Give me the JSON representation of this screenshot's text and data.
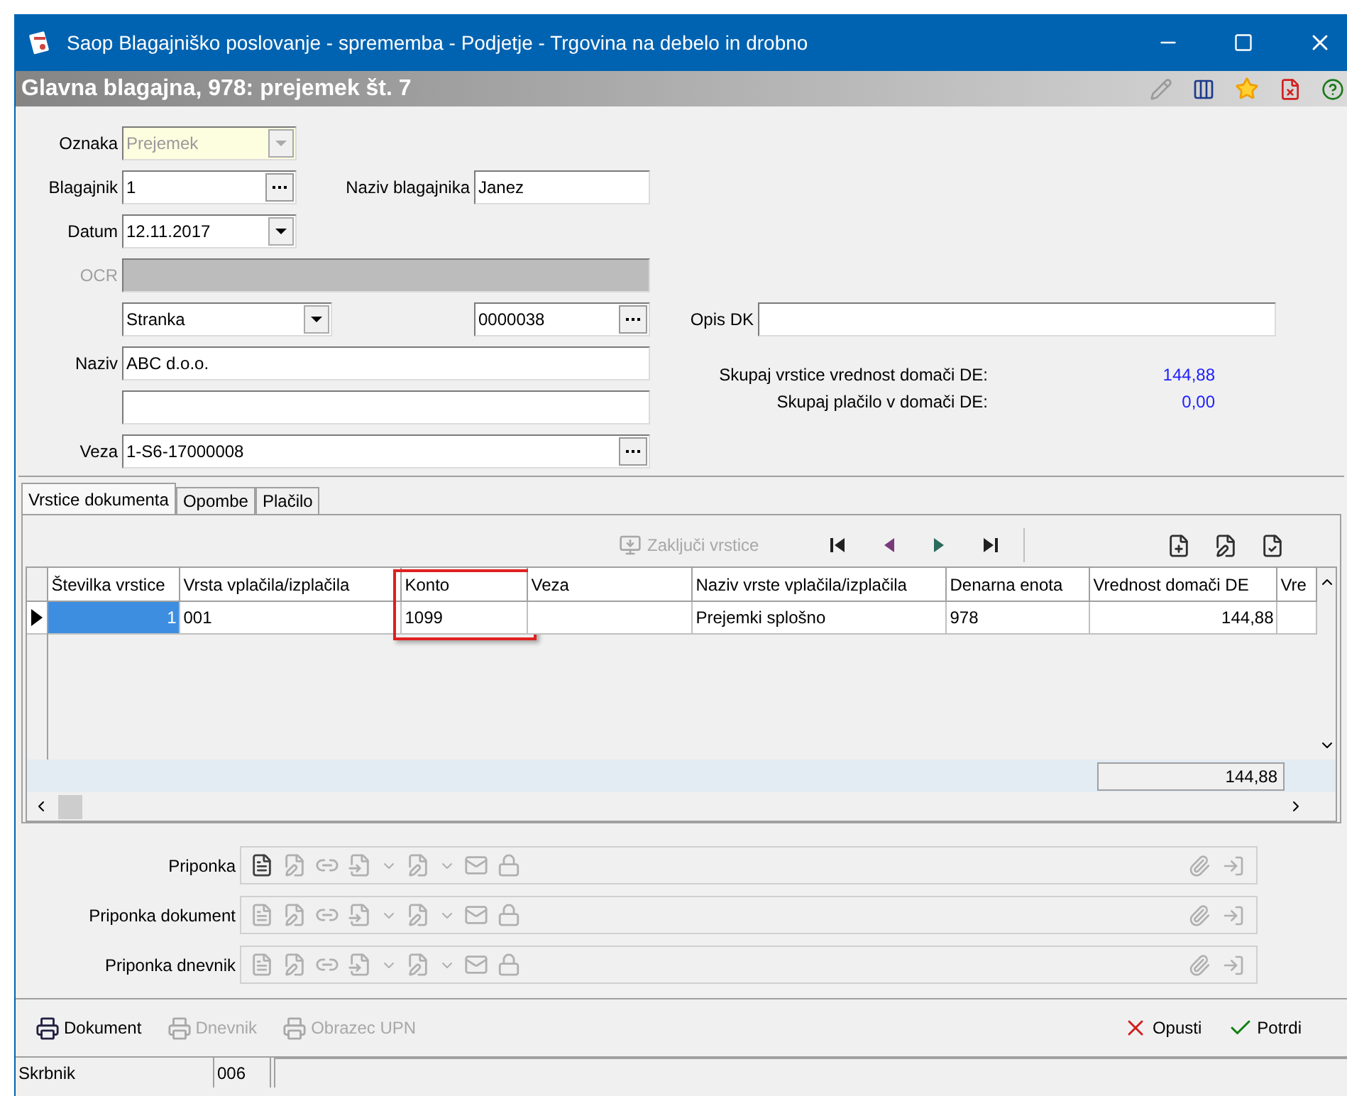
{
  "window": {
    "title": "Saop Blagajniško poslovanje - sprememba - Podjetje - Trgovina na debelo in drobno"
  },
  "header": {
    "title": "Glavna blagajna, 978: prejemek št. 7"
  },
  "form": {
    "oznaka": {
      "label": "Oznaka",
      "value": "Prejemek",
      "disabled": true
    },
    "blagajnik": {
      "label": "Blagajnik",
      "value": "1"
    },
    "naziv_blagajnika": {
      "label": "Naziv blagajnika",
      "value": "Janez"
    },
    "datum": {
      "label": "Datum",
      "value": "12.11.2017"
    },
    "ocr": {
      "label": "OCR",
      "disabled": true
    },
    "partner_type": {
      "value": "Stranka"
    },
    "partner_code": {
      "value": "0000038"
    },
    "opis_dk": {
      "label": "Opis DK"
    },
    "naziv": {
      "label": "Naziv",
      "value": "ABC d.o.o."
    },
    "veza": {
      "label": "Veza",
      "value": "1-S6-17000008"
    }
  },
  "totals": [
    {
      "label": "Skupaj vrstice vrednost domači DE:",
      "value": "144,88"
    },
    {
      "label": "Skupaj plačilo v domači DE:",
      "value": "0,00"
    }
  ],
  "tabs": [
    {
      "label": "Vrstice dokumenta",
      "selected": true
    },
    {
      "label": "Opombe",
      "selected": false
    },
    {
      "label": "Plačilo",
      "selected": false
    }
  ],
  "grid_toolbar": {
    "close_rows": {
      "label": "Zaključi vrstice",
      "disabled": true
    }
  },
  "grid": {
    "columns": [
      {
        "header": "Številka vrstice",
        "highlighted": false
      },
      {
        "header": "Vrsta vplačila/izplačila",
        "highlighted": false
      },
      {
        "header": "Konto",
        "highlighted": true
      },
      {
        "header": "Veza",
        "highlighted": false
      },
      {
        "header": "Naziv vrste vplačila/izplačila",
        "highlighted": false
      },
      {
        "header": "Denarna enota",
        "highlighted": false
      },
      {
        "header": "Vrednost domači DE",
        "highlighted": false
      },
      {
        "header": "Vre",
        "highlighted": false
      }
    ],
    "rows": [
      {
        "selected": true,
        "cells": [
          "1",
          "001",
          "1099",
          null,
          "Prejemki splošno",
          "978",
          "144,88",
          null
        ]
      }
    ],
    "footer_total": "144,88"
  },
  "attachments": [
    {
      "label": "Priponka",
      "new_enabled": true
    },
    {
      "label": "Priponka dokument",
      "new_enabled": false
    },
    {
      "label": "Priponka dnevnik",
      "new_enabled": false
    }
  ],
  "buttons": [
    {
      "label": "Dokument",
      "kind": "print",
      "disabled": false
    },
    {
      "label": "Dnevnik",
      "kind": "print",
      "disabled": true
    },
    {
      "label": "Obrazec UPN",
      "kind": "print",
      "disabled": true
    },
    {
      "label": "Opusti",
      "kind": "cancel",
      "disabled": false
    },
    {
      "label": "Potrdi",
      "kind": "confirm",
      "disabled": false
    }
  ],
  "status_bar": [
    "Skrbnik",
    "006"
  ]
}
